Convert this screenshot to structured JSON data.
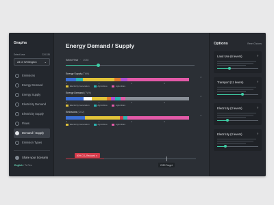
{
  "sidebar": {
    "brand": "Graphs",
    "area_label": "Select Area",
    "area_count": "224.336",
    "area_value": "All of Wellington",
    "items": [
      {
        "label": "Emissions",
        "icon": "cloud-icon",
        "active": false
      },
      {
        "label": "Energy Demand",
        "icon": "bolt-icon",
        "active": false
      },
      {
        "label": "Energy Supply",
        "icon": "plug-icon",
        "active": false
      },
      {
        "label": "Electricity Demand",
        "icon": "lightning-icon",
        "active": false
      },
      {
        "label": "Electricity Supply",
        "icon": "tower-icon",
        "active": false
      },
      {
        "label": "Flows",
        "icon": "flow-icon",
        "active": false
      },
      {
        "label": "Demand / Supply",
        "icon": "scale-icon",
        "active": true
      },
      {
        "label": "Emission Types",
        "icon": "layers-icon",
        "active": false
      }
    ],
    "share_label": "Share your Scenario",
    "lang_active": "English",
    "lang_other": "Te Reo"
  },
  "main": {
    "title": "Energy Demand / Supply",
    "year_label": "Select Year",
    "year_value": "2035",
    "year_fraction": 0.25,
    "charts": [
      {
        "name": "Energy Supply",
        "unit": "(TWh)",
        "max_label": "4",
        "ticks": [
          "0",
          "1",
          "2",
          "3"
        ],
        "segments": [
          {
            "color": "#3b6fd6",
            "value": 0.2
          },
          {
            "color": "#2bb3b1",
            "value": 0.13
          },
          {
            "color": "#e2c43a",
            "value": 0.62
          },
          {
            "color": "#e07a2e",
            "value": 0.12
          },
          {
            "color": "#b04fd3",
            "value": 0.13
          },
          {
            "color": "#e35aa8",
            "value": 1.2
          }
        ],
        "legend": [
          {
            "label": "Electricity Generation",
            "color": "#e2c43a"
          },
          {
            "label": "Agriculture",
            "color": "#2bb3b1"
          },
          {
            "label": "Agriculture",
            "color": "#e35aa8"
          }
        ]
      },
      {
        "name": "Energy Demand",
        "unit": "(TWh)",
        "max_label": "4",
        "ticks": [
          "0",
          "1",
          "2",
          "3"
        ],
        "segments": [
          {
            "color": "#3b6fd6",
            "value": 0.35
          },
          {
            "color": "#ffffff",
            "value": 0.15
          },
          {
            "color": "#e2c43a",
            "value": 0.3
          },
          {
            "color": "#e07a2e",
            "value": 0.08
          },
          {
            "color": "#b04fd3",
            "value": 0.08
          },
          {
            "color": "#2bb3b1",
            "value": 0.1
          },
          {
            "color": "#e35aa8",
            "value": 0.1
          },
          {
            "color": "#8a9098",
            "value": 1.24
          }
        ],
        "legend": [
          {
            "label": "Electricity Generation",
            "color": "#e2c43a"
          },
          {
            "label": "Agriculture",
            "color": "#2bb3b1"
          },
          {
            "label": "Agriculture",
            "color": "#e35aa8"
          }
        ]
      },
      {
        "name": "Emissions",
        "unit": "(CO2)",
        "max_label": "4",
        "ticks": [
          "0",
          "1",
          "2",
          "3"
        ],
        "segments": [
          {
            "color": "#3b6fd6",
            "value": 0.25
          },
          {
            "color": "#e2c43a",
            "value": 0.45
          },
          {
            "color": "#d63a4a",
            "value": 0.05
          },
          {
            "color": "#2bb3b1",
            "value": 0.05
          },
          {
            "color": "#e35aa8",
            "value": 0.8
          }
        ],
        "legend": [
          {
            "label": "Electricity Generation",
            "color": "#e2c43a"
          },
          {
            "label": "Agriculture",
            "color": "#2bb3b1"
          },
          {
            "label": "Agriculture",
            "color": "#e35aa8"
          }
        ]
      }
    ],
    "target_badge": "80% CO₂ Reduced ✕",
    "target_label": "2050 Target"
  },
  "options": {
    "title": "Options",
    "reset_label": "Reset Choices",
    "cards": [
      {
        "title": "Land Use (6 levers)",
        "fraction": 0.3
      },
      {
        "title": "Transport (11 levers)",
        "fraction": 0.6
      },
      {
        "title": "Electricity (3 levers)",
        "fraction": 0.25
      },
      {
        "title": "Electricity (3 levers)",
        "fraction": 0.2
      }
    ]
  }
}
